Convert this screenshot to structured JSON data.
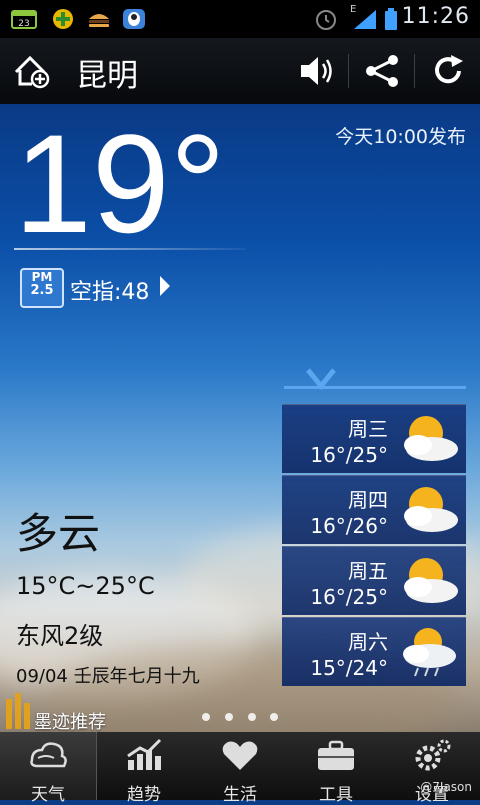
{
  "status_bar": {
    "time": "11:26",
    "notification_badge": "23",
    "network_letter": "E",
    "icons": [
      "calendar-icon",
      "app-icon",
      "burger-icon",
      "qq-icon",
      "alarm-icon",
      "signal-icon",
      "battery-icon"
    ]
  },
  "header": {
    "city": "昆明",
    "icons": [
      "add-city-icon",
      "volume-icon",
      "share-icon",
      "refresh-icon"
    ]
  },
  "current": {
    "temperature": "19°",
    "published": "今天10:00发布",
    "pm_badge_top": "PM",
    "pm_badge_bottom": "2.5",
    "aqi": "空指:48",
    "condition": "多云",
    "range": "15°C~25°C",
    "wind": "东风2级",
    "date": "09/04 壬辰年七月十九"
  },
  "promo": {
    "label": "墨迹推荐"
  },
  "page_indicator": {
    "count": 4,
    "active": 1
  },
  "forecast": [
    {
      "day": "周三",
      "range": "16°/25°",
      "icon": "partly-cloudy-icon"
    },
    {
      "day": "周四",
      "range": "16°/26°",
      "icon": "partly-cloudy-icon"
    },
    {
      "day": "周五",
      "range": "16°/25°",
      "icon": "partly-cloudy-icon"
    },
    {
      "day": "周六",
      "range": "15°/24°",
      "icon": "cloudy-rain-icon"
    }
  ],
  "nav": [
    {
      "label": "天气",
      "icon": "weather-cloud-icon",
      "active": true
    },
    {
      "label": "趋势",
      "icon": "trend-chart-icon",
      "active": false
    },
    {
      "label": "生活",
      "icon": "heart-icon",
      "active": false
    },
    {
      "label": "工具",
      "icon": "toolbox-icon",
      "active": false
    },
    {
      "label": "设置",
      "icon": "settings-gear-icon",
      "active": false
    }
  ],
  "watermark": "@7Jason",
  "colors": {
    "accent": "#3b7bd0",
    "forecast_line": "#5ba6ee"
  }
}
